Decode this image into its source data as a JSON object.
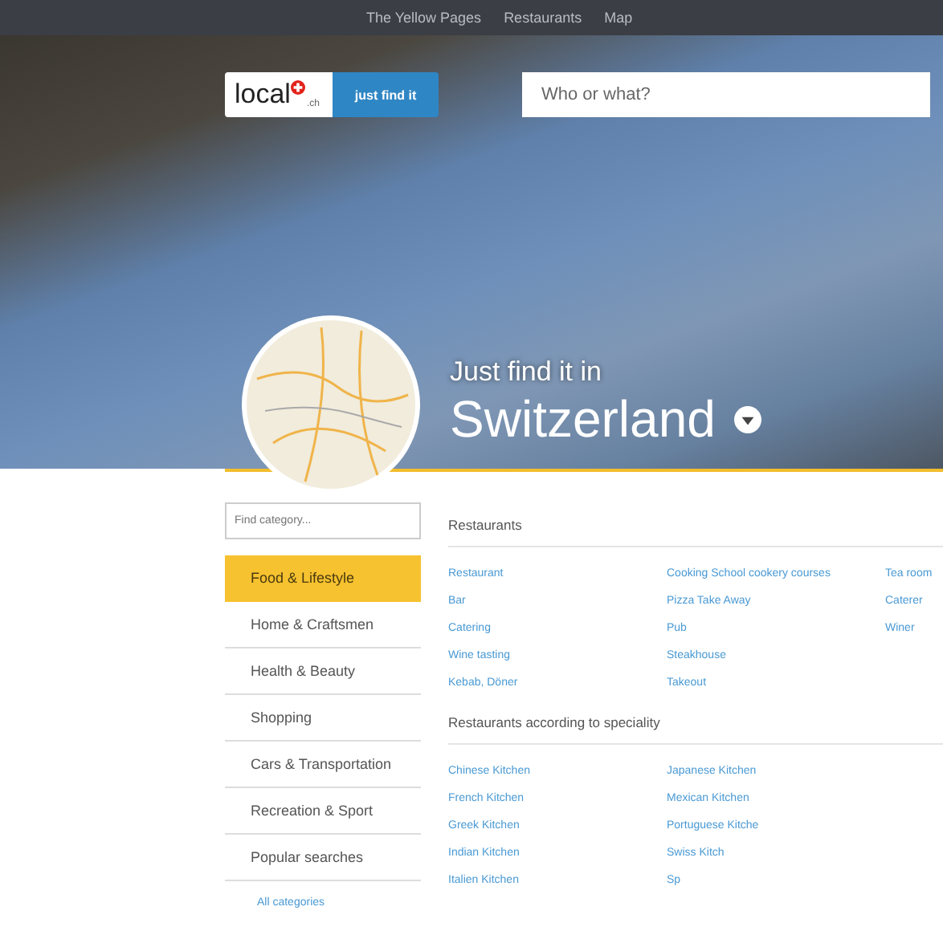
{
  "nav_links": [
    "The Yellow Pages",
    "Restaurants",
    "Map"
  ],
  "logo": {
    "text": "local",
    "suffix": ".ch"
  },
  "slogan_button": "just find it",
  "search": {
    "placeholder": "Who or what?"
  },
  "hero": {
    "kicker": "Just find it in",
    "country": "Switzerland"
  },
  "sidebar": {
    "search_placeholder": "Find category...",
    "items": [
      {
        "label": "Food & Lifestyle",
        "selected": true
      },
      {
        "label": "Home & Craftsmen",
        "selected": false
      },
      {
        "label": "Health & Beauty",
        "selected": false
      },
      {
        "label": "Shopping",
        "selected": false
      },
      {
        "label": "Cars & Transportation",
        "selected": false
      },
      {
        "label": "Recreation & Sport",
        "selected": false
      },
      {
        "label": "Popular searches",
        "selected": false
      }
    ],
    "all_link": "All categories"
  },
  "sections": [
    {
      "title": "Restaurants",
      "columns": [
        [
          "Restaurant",
          "Bar",
          "Catering",
          "Wine tasting",
          "Kebab, Döner"
        ],
        [
          "Cooking School cookery courses",
          "Pizza Take Away",
          "Pub",
          "Steakhouse",
          "Takeout"
        ],
        [
          "Tea room",
          "Caterer",
          "Winer"
        ]
      ]
    },
    {
      "title": "Restaurants according to speciality",
      "columns": [
        [
          "Chinese Kitchen",
          "French Kitchen",
          "Greek Kitchen",
          "Indian Kitchen",
          "Italien Kitchen"
        ],
        [
          "Japanese Kitchen",
          "Mexican Kitchen",
          "Portuguese Kitche",
          "Swiss Kitch",
          "Sp"
        ]
      ]
    }
  ]
}
